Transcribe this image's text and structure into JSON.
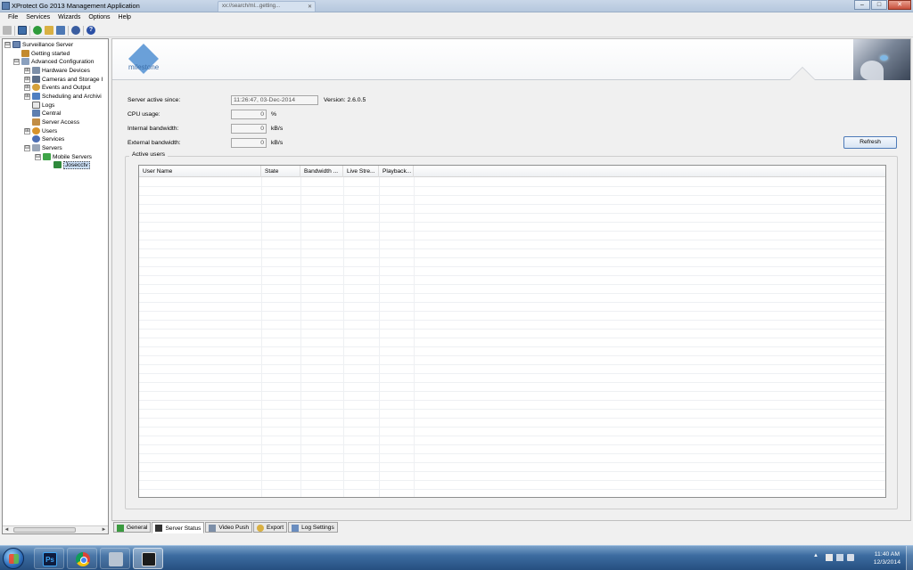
{
  "window": {
    "title": "XProtect Go 2013 Management Application",
    "background_tab": "xx://search/ml...getting...",
    "buttons": {
      "minimize": "–",
      "maximize": "□",
      "close": "✕"
    }
  },
  "menu": [
    "File",
    "Services",
    "Wizards",
    "Options",
    "Help"
  ],
  "toolbar": {
    "icons": [
      "back-icon",
      "save-icon",
      "refresh-icon",
      "open-folder-icon",
      "device-icon",
      "wizard-icon",
      "help-icon"
    ],
    "help_glyph": "?"
  },
  "tree": {
    "items": [
      {
        "label": "Surveillance Server",
        "expander": "⊟",
        "icon": "server-icon"
      },
      {
        "label": "Getting started",
        "expander": "",
        "icon": "getting-started-icon"
      },
      {
        "label": "Advanced Configuration",
        "expander": "⊟",
        "icon": "advanced-config-icon"
      },
      {
        "label": "Hardware Devices",
        "expander": "⊞",
        "icon": "hardware-icon"
      },
      {
        "label": "Cameras and Storage I",
        "expander": "⊞",
        "icon": "camera-icon"
      },
      {
        "label": "Events and Output",
        "expander": "⊞",
        "icon": "events-icon"
      },
      {
        "label": "Scheduling and Archivi",
        "expander": "⊞",
        "icon": "schedule-icon"
      },
      {
        "label": "Logs",
        "expander": "",
        "icon": "logs-icon"
      },
      {
        "label": "Central",
        "expander": "",
        "icon": "central-icon"
      },
      {
        "label": "Server Access",
        "expander": "",
        "icon": "server-access-icon"
      },
      {
        "label": "Users",
        "expander": "⊞",
        "icon": "users-icon"
      },
      {
        "label": "Services",
        "expander": "",
        "icon": "services-icon"
      },
      {
        "label": "Servers",
        "expander": "⊟",
        "icon": "servers-icon"
      },
      {
        "label": "Mobile Servers",
        "expander": "⊟",
        "icon": "mobile-server-icon"
      },
      {
        "label": "Josecctv",
        "expander": "",
        "icon": "mobile-server-node-icon",
        "selected": true
      }
    ],
    "scroll_left": "◄",
    "scroll_right": "►"
  },
  "status": {
    "server_active_label": "Server active since:",
    "server_active_value": "11:26:47, 03-Dec-2014",
    "version": "Version: 2.6.0.5",
    "cpu_label": "CPU usage:",
    "cpu_value": "0",
    "cpu_unit": "%",
    "internal_bw_label": "Internal bandwidth:",
    "internal_bw_value": "0",
    "internal_bw_unit": "kB/s",
    "external_bw_label": "External bandwidth:",
    "external_bw_value": "0",
    "external_bw_unit": "kB/s",
    "refresh_label": "Refresh",
    "active_users_label": "Active users",
    "columns": [
      "User Name",
      "State",
      "Bandwidth ...",
      "Live Stre...",
      "Playback..."
    ]
  },
  "logo_text": "milestone",
  "tabs": [
    {
      "label": "General",
      "icon": "general-tab-icon",
      "active": false
    },
    {
      "label": "Server Status",
      "icon": "server-status-tab-icon",
      "active": true
    },
    {
      "label": "Video Push",
      "icon": "video-push-tab-icon",
      "active": false
    },
    {
      "label": "Export",
      "icon": "export-tab-icon",
      "active": false
    },
    {
      "label": "Log Settings",
      "icon": "log-settings-tab-icon",
      "active": false
    }
  ],
  "taskbar": {
    "apps": [
      "photoshop-icon",
      "chrome-icon",
      "network-app-icon",
      "milestone-app-icon"
    ],
    "ps_glyph": "Ps",
    "tray_arrow": "▲",
    "time": "11:40 AM",
    "date": "12/3/2014"
  }
}
